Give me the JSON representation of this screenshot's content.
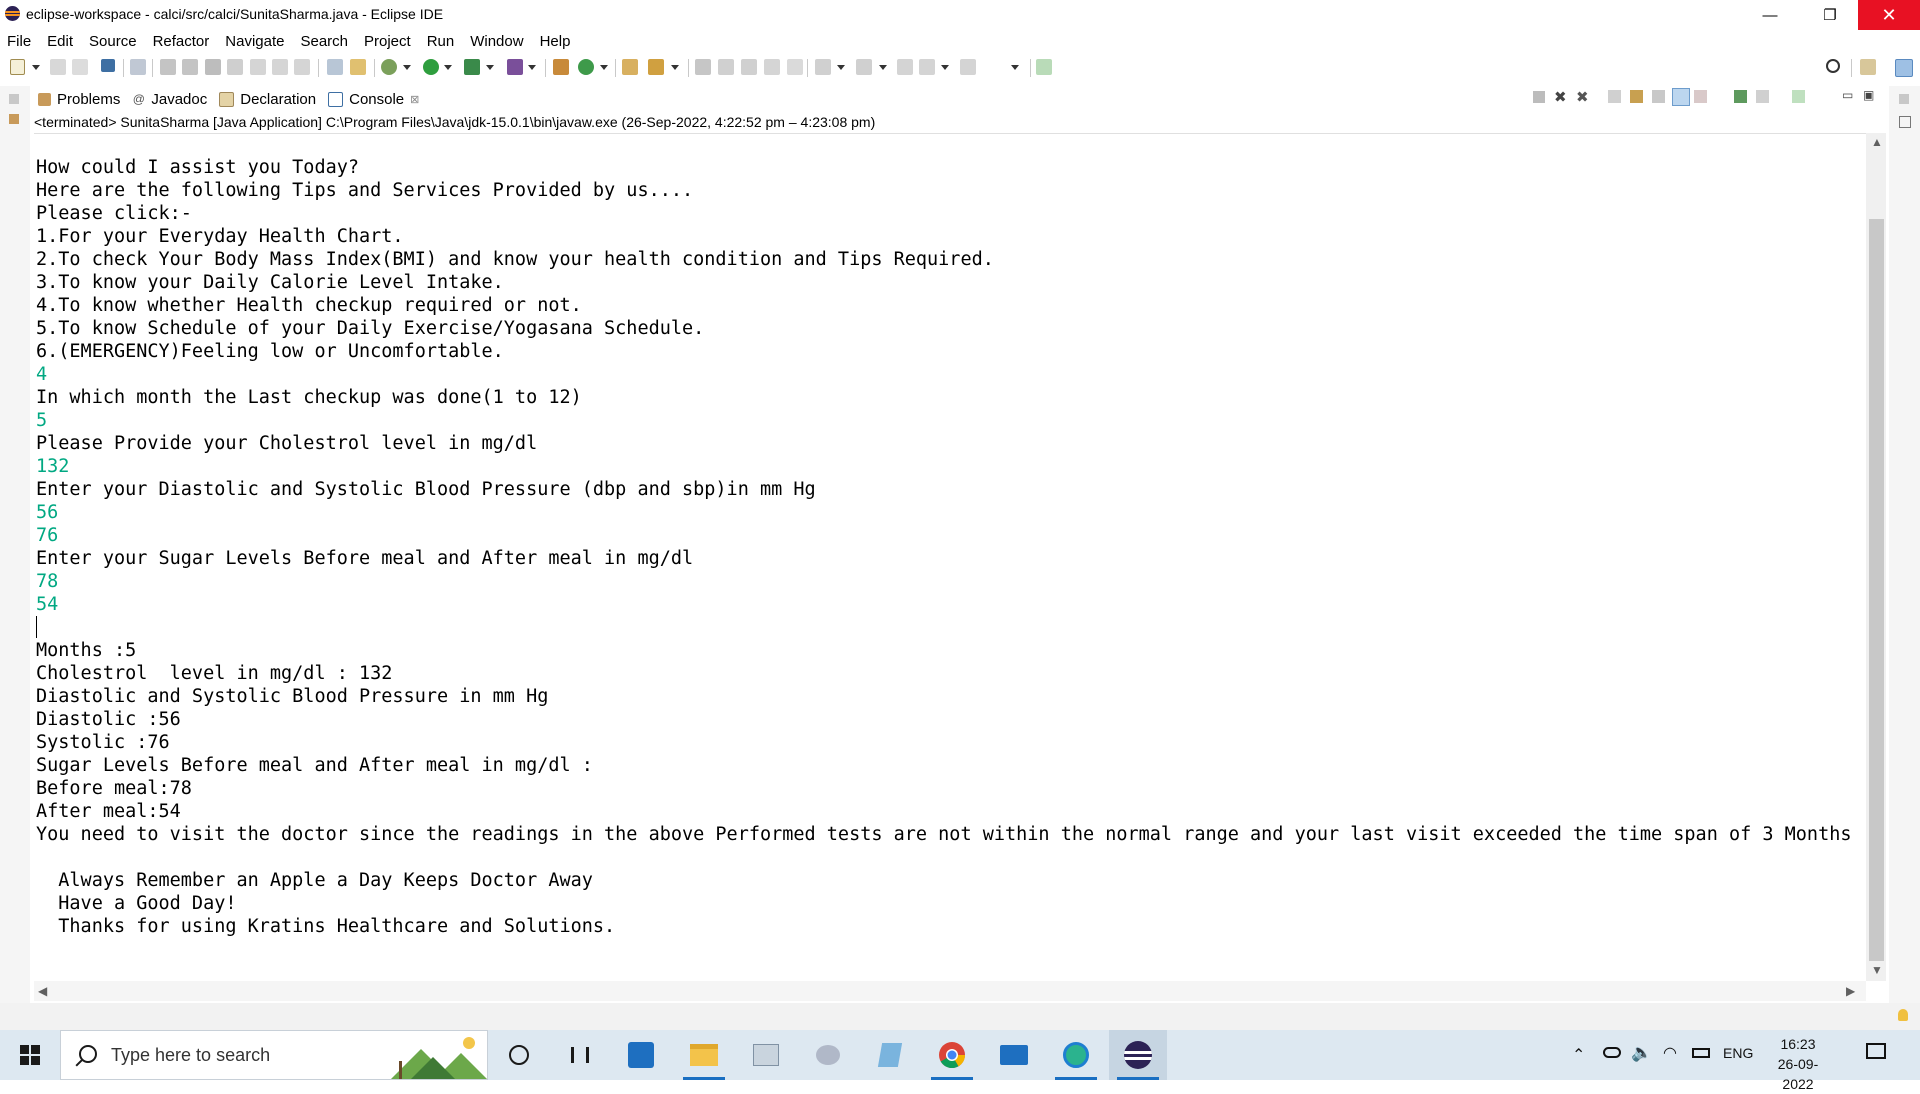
{
  "window": {
    "title": "eclipse-workspace - calci/src/calci/SunitaSharma.java - Eclipse IDE",
    "minimize": "—",
    "maximize": "❐",
    "close": "✕"
  },
  "menu": {
    "items": [
      "File",
      "Edit",
      "Source",
      "Refactor",
      "Navigate",
      "Search",
      "Project",
      "Run",
      "Window",
      "Help"
    ]
  },
  "view_tabs": [
    {
      "label": "Problems",
      "icon": "problems-icon"
    },
    {
      "label": "Javadoc",
      "icon": "javadoc-icon"
    },
    {
      "label": "Declaration",
      "icon": "declaration-icon"
    },
    {
      "label": "Console",
      "icon": "console-icon",
      "active": true,
      "close": "⊠"
    }
  ],
  "console": {
    "header": "<terminated> SunitaSharma [Java Application] C:\\Program Files\\Java\\jdk-15.0.1\\bin\\javaw.exe  (26-Sep-2022, 4:22:52 pm – 4:23:08 pm)",
    "lines": [
      {
        "text": "How could I assist you Today?",
        "type": "out"
      },
      {
        "text": "Here are the following Tips and Services Provided by us....",
        "type": "out"
      },
      {
        "text": "Please click:-",
        "type": "out"
      },
      {
        "text": "1.For your Everyday Health Chart.",
        "type": "out"
      },
      {
        "text": "2.To check Your Body Mass Index(BMI) and know your health condition and Tips Required.",
        "type": "out"
      },
      {
        "text": "3.To know your Daily Calorie Level Intake.",
        "type": "out"
      },
      {
        "text": "4.To know whether Health checkup required or not.",
        "type": "out"
      },
      {
        "text": "5.To know Schedule of your Daily Exercise/Yogasana Schedule.",
        "type": "out"
      },
      {
        "text": "6.(EMERGENCY)Feeling low or Uncomfortable.",
        "type": "out"
      },
      {
        "text": "4",
        "type": "in"
      },
      {
        "text": "In which month the Last checkup was done(1 to 12)",
        "type": "out"
      },
      {
        "text": "5",
        "type": "in"
      },
      {
        "text": "Please Provide your Cholestrol level in mg/dl",
        "type": "out"
      },
      {
        "text": "132",
        "type": "in"
      },
      {
        "text": "Enter your Diastolic and Systolic Blood Pressure (dbp and sbp)in mm Hg",
        "type": "out"
      },
      {
        "text": "56",
        "type": "in"
      },
      {
        "text": "76",
        "type": "in"
      },
      {
        "text": "Enter your Sugar Levels Before meal and After meal in mg/dl",
        "type": "out"
      },
      {
        "text": "78",
        "type": "in"
      },
      {
        "text": "54",
        "type": "in"
      },
      {
        "text": "",
        "type": "out"
      },
      {
        "text": "Months :5",
        "type": "out"
      },
      {
        "text": "Cholestrol  level in mg/dl : 132",
        "type": "out"
      },
      {
        "text": "Diastolic and Systolic Blood Pressure in mm Hg",
        "type": "out"
      },
      {
        "text": "Diastolic :56",
        "type": "out"
      },
      {
        "text": "Systolic :76",
        "type": "out"
      },
      {
        "text": "Sugar Levels Before meal and After meal in mg/dl :",
        "type": "out"
      },
      {
        "text": "Before meal:78",
        "type": "out"
      },
      {
        "text": "After meal:54",
        "type": "out"
      },
      {
        "text": "You need to visit the doctor since the readings in the above Performed tests are not within the normal range and your last visit exceeded the time span of 3 Months",
        "type": "out"
      },
      {
        "text": "",
        "type": "out"
      },
      {
        "text": "  Always Remember an Apple a Day Keeps Doctor Away",
        "type": "out"
      },
      {
        "text": "  Have a Good Day!",
        "type": "out"
      },
      {
        "text": "  Thanks for using Kratins Healthcare and Solutions.",
        "type": "out"
      }
    ]
  },
  "taskbar": {
    "search_placeholder": "Type here to search",
    "language": "ENG",
    "time": "16:23",
    "date": "26-09-2022"
  },
  "colors": {
    "input_text": "#00a882",
    "close_button": "#e81123",
    "taskbar_bg": "#dde8f1"
  }
}
